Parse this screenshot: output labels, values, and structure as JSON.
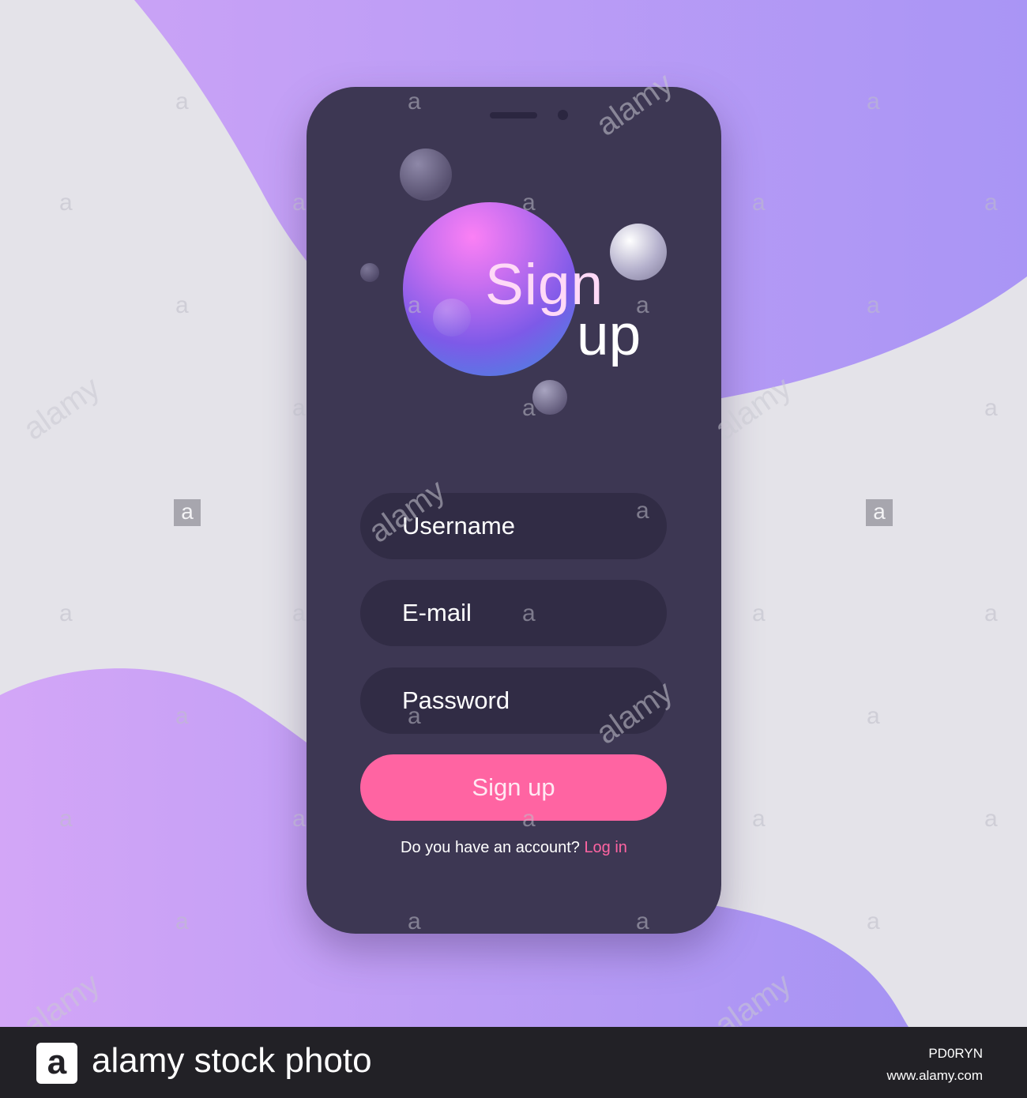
{
  "colors": {
    "background": "#e4e3e9",
    "blob_purple": "#b592f7",
    "phone_body": "#3d3753",
    "field_bg": "#312c45",
    "accent_pink": "#ff64a2"
  },
  "header": {
    "title_line1": "Sign",
    "title_line2": "up"
  },
  "form": {
    "username_placeholder": "Username",
    "email_placeholder": "E-mail",
    "password_placeholder": "Password",
    "submit_label": "Sign up"
  },
  "footer_prompt": {
    "question": "Do you have an account?",
    "login_link": "Log in"
  },
  "watermark": {
    "letter": "a",
    "word": "alamy",
    "brand": "alamy stock photo",
    "image_id": "PD0RYN",
    "url": "www.alamy.com"
  }
}
